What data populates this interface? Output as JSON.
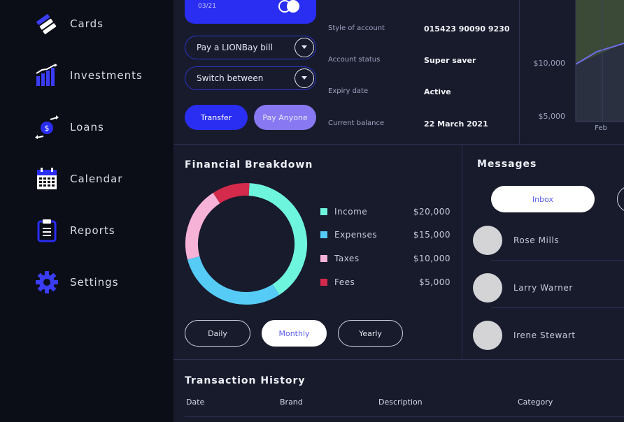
{
  "sidebar": {
    "items": [
      {
        "label": "Cards",
        "icon": "cards-icon"
      },
      {
        "label": "Investments",
        "icon": "investments-icon"
      },
      {
        "label": "Loans",
        "icon": "loans-icon"
      },
      {
        "label": "Calendar",
        "icon": "calendar-icon"
      },
      {
        "label": "Reports",
        "icon": "reports-icon"
      },
      {
        "label": "Settings",
        "icon": "settings-icon"
      }
    ]
  },
  "card": {
    "expiry": "03/21",
    "actions": [
      {
        "label": "Pay a LIONBay bill"
      },
      {
        "label": "Switch between"
      }
    ],
    "transfer_label": "Transfer",
    "pay_anyone_label": "Pay Anyone"
  },
  "account": {
    "rows": [
      {
        "label": "Style of account",
        "value": "015423 90090 9230"
      },
      {
        "label": "Account status",
        "value": "Super saver"
      },
      {
        "label": "Expiry date",
        "value": "Active"
      },
      {
        "label": "Current balance",
        "value": "22 March 2021"
      }
    ]
  },
  "mini_chart": {
    "y_ticks": [
      "$10,000",
      "$5,000"
    ],
    "x_label": "Feb"
  },
  "breakdown": {
    "title": "Financial Breakdown",
    "legend": [
      {
        "name": "Income",
        "value": "$20,000",
        "color": "#6ef5de"
      },
      {
        "name": "Expenses",
        "value": "$15,000",
        "color": "#56cbf6"
      },
      {
        "name": "Taxes",
        "value": "$10,000",
        "color": "#f7b2d8"
      },
      {
        "name": "Fees",
        "value": "$5,000",
        "color": "#d42a4b"
      }
    ],
    "periods": [
      {
        "label": "Daily",
        "active": false
      },
      {
        "label": "Monthly",
        "active": true
      },
      {
        "label": "Yearly",
        "active": false
      }
    ]
  },
  "chart_data": {
    "type": "pie",
    "categories": [
      "Income",
      "Expenses",
      "Taxes",
      "Fees"
    ],
    "values": [
      20000,
      15000,
      10000,
      5000
    ],
    "colors": [
      "#6ef5de",
      "#56cbf6",
      "#f7b2d8",
      "#d42a4b"
    ]
  },
  "messages": {
    "title": "Messages",
    "tab_inbox": "Inbox",
    "contacts": [
      {
        "name": "Rose Mills"
      },
      {
        "name": "Larry Warner"
      },
      {
        "name": "Irene Stewart"
      }
    ]
  },
  "transactions": {
    "title": "Transaction History",
    "columns": [
      "Date",
      "Brand",
      "Description",
      "Category"
    ]
  },
  "colors": {
    "accent": "#2a2df2",
    "accent_soft": "#8879f3",
    "sidebar_bg": "#0b0d17",
    "panel_bg": "#181b2c"
  }
}
